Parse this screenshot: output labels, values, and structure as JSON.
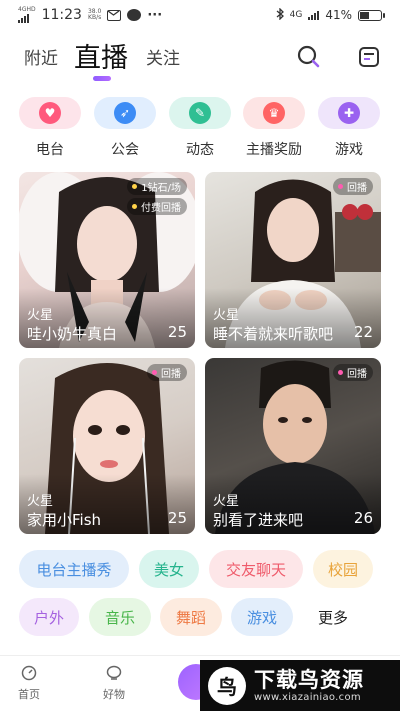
{
  "status_bar": {
    "network": "4GHD",
    "time": "11:23",
    "speed_value": "38.0",
    "speed_unit": "KB/s",
    "more": "···",
    "net_right": "4G",
    "battery": "41%"
  },
  "header": {
    "tabs": [
      {
        "label": "附近",
        "active": false
      },
      {
        "label": "直播",
        "active": true
      },
      {
        "label": "关注",
        "active": false
      }
    ],
    "icons": [
      "search-icon",
      "menu-icon"
    ]
  },
  "categories": [
    {
      "label": "电台",
      "icon": "heart-icon",
      "bg": "#fde4ea",
      "fg": "#ff5a7d"
    },
    {
      "label": "公会",
      "icon": "wing-icon",
      "bg": "#e1eefe",
      "fg": "#3d8cf5"
    },
    {
      "label": "动态",
      "icon": "note-icon",
      "bg": "#dcf5ee",
      "fg": "#2fbf93"
    },
    {
      "label": "主播奖励",
      "icon": "trophy-icon",
      "bg": "#fde4e4",
      "fg": "#ff6464"
    },
    {
      "label": "游戏",
      "icon": "game-icon",
      "bg": "#efe5fb",
      "fg": "#9a62f0"
    }
  ],
  "cards": [
    {
      "badges": [
        "1钻石/场",
        "付费回播"
      ],
      "tag": "火星",
      "title": "哇小奶牛真白",
      "count": "25"
    },
    {
      "badges": [
        "回播"
      ],
      "tag": "火星",
      "title": "睡不着就来听歌吧",
      "count": "22"
    },
    {
      "badges": [
        "回播"
      ],
      "tag": "火星",
      "title": "家用小Fish",
      "count": "25"
    },
    {
      "badges": [
        "回播"
      ],
      "tag": "火星",
      "title": "别看了进来吧",
      "count": "26"
    }
  ],
  "chips": [
    {
      "label": "电台主播秀",
      "bg": "#e3eefb",
      "fg": "#4a8fe0"
    },
    {
      "label": "美女",
      "bg": "#d9f5ee",
      "fg": "#25b38c"
    },
    {
      "label": "交友聊天",
      "bg": "#fde6e8",
      "fg": "#ef5b6b"
    },
    {
      "label": "校园",
      "bg": "#fdf3df",
      "fg": "#e8a33a"
    },
    {
      "label": "户外",
      "bg": "#f4e8fb",
      "fg": "#a562e0"
    },
    {
      "label": "音乐",
      "bg": "#e6f7e3",
      "fg": "#48b54a"
    },
    {
      "label": "舞蹈",
      "bg": "#fdebdf",
      "fg": "#ee7a45"
    },
    {
      "label": "游戏",
      "bg": "#e3eefb",
      "fg": "#4a8fe0"
    },
    {
      "label": "更多",
      "bg": "#ffffff",
      "fg": "#222222"
    }
  ],
  "bottom_nav": [
    {
      "label": "首页",
      "icon": "home-icon"
    },
    {
      "label": "好物",
      "icon": "shop-icon"
    }
  ],
  "watermark": {
    "logo": "鸟",
    "title": "下载鸟资源",
    "url": "www.xiazainiao.com"
  },
  "colors": {
    "accent": "#9a62f0"
  }
}
